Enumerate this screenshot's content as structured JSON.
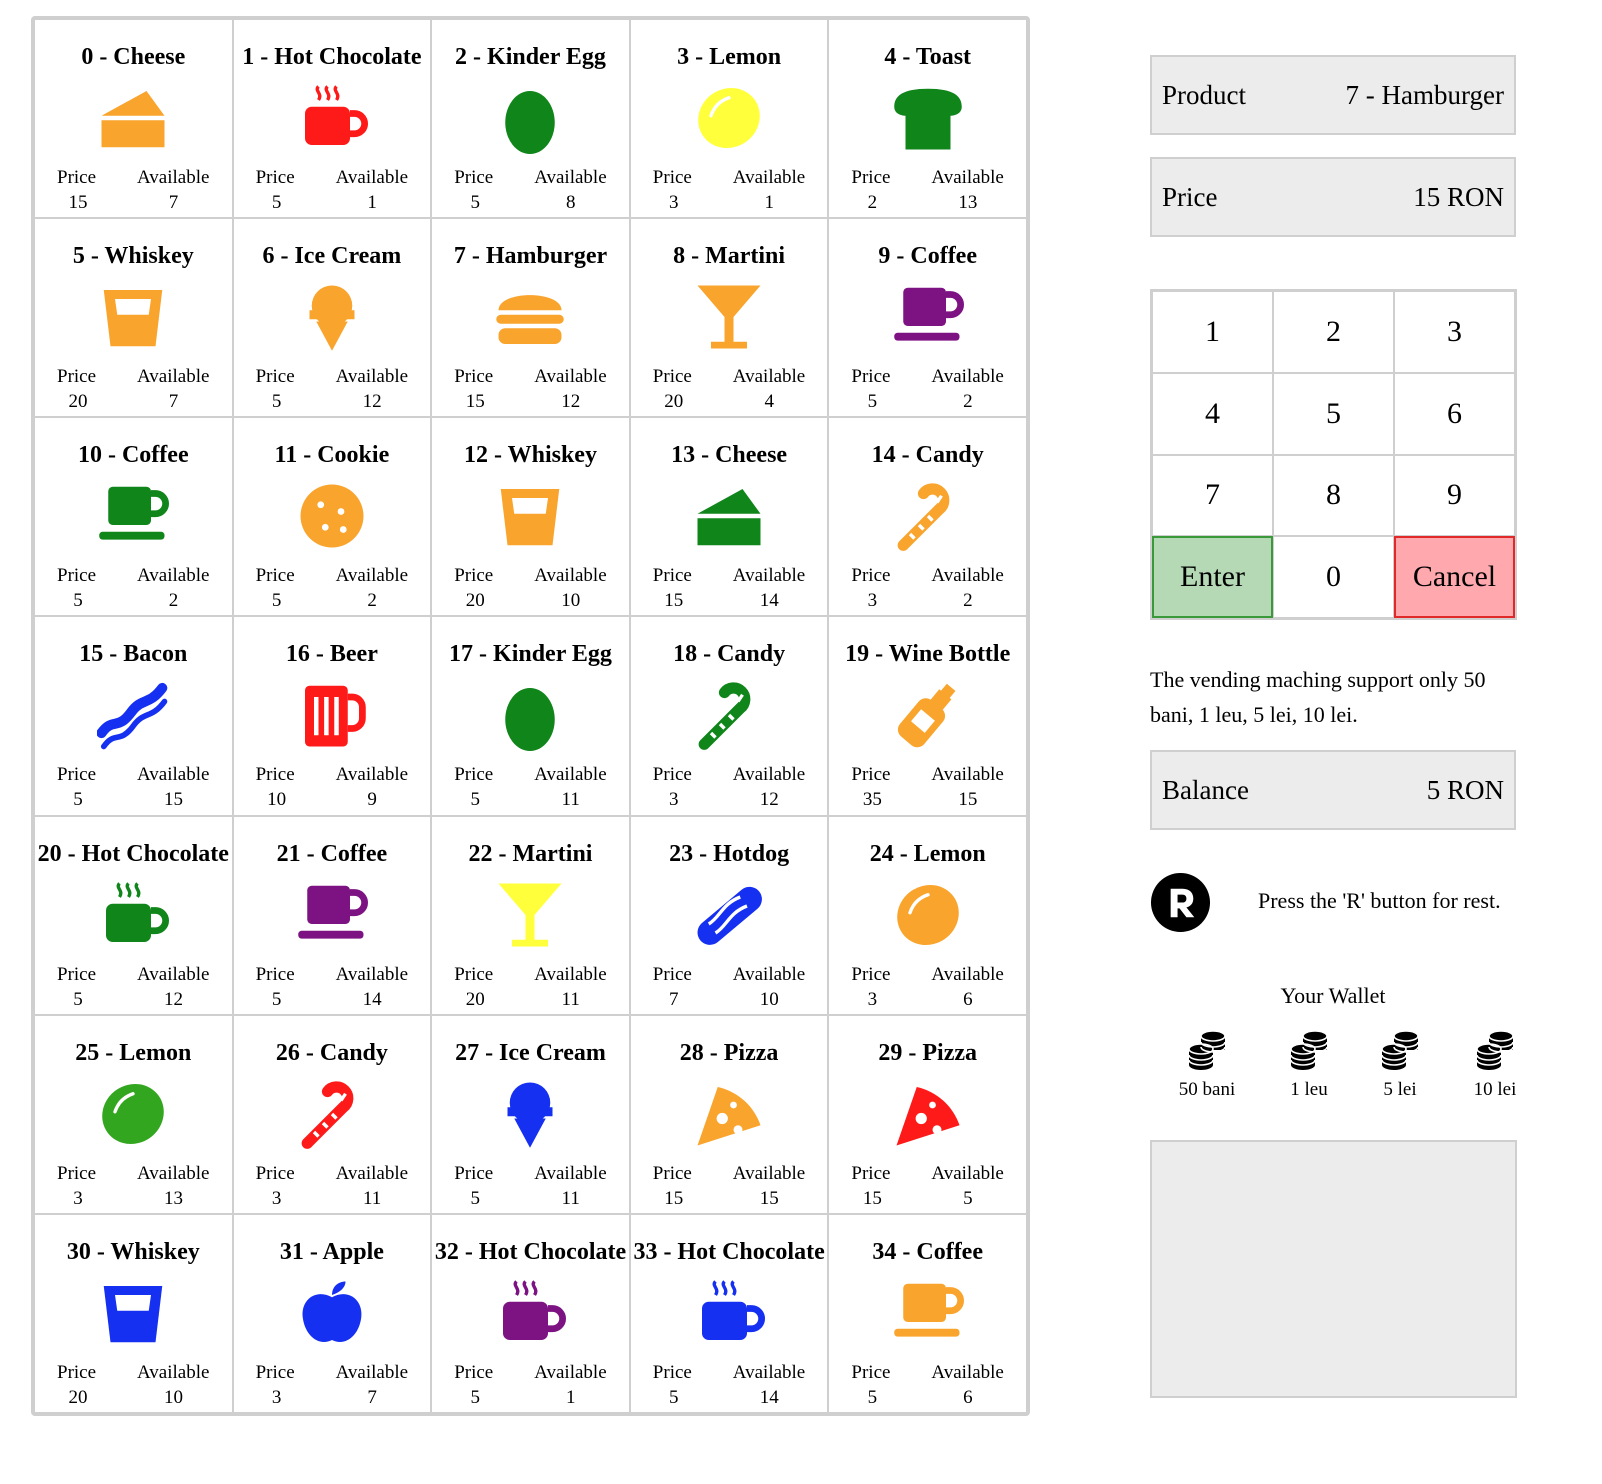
{
  "products": [
    {
      "name": "0 - Cheese",
      "icon": "cheese-icon",
      "color": "#f9a42c",
      "price": "15",
      "available": "7"
    },
    {
      "name": "1 - Hot Chocolate",
      "icon": "hot-drink-icon",
      "color": "#ff1a1a",
      "price": "5",
      "available": "1"
    },
    {
      "name": "2 - Kinder Egg",
      "icon": "egg-icon",
      "color": "#10851a",
      "price": "5",
      "available": "8"
    },
    {
      "name": "3 - Lemon",
      "icon": "lemon-icon",
      "color": "#ffff3b",
      "price": "3",
      "available": "1"
    },
    {
      "name": "4 - Toast",
      "icon": "bread-slice-icon",
      "color": "#10851a",
      "price": "2",
      "available": "13"
    },
    {
      "name": "5 - Whiskey",
      "icon": "glass-icon",
      "color": "#f9a42c",
      "price": "20",
      "available": "7"
    },
    {
      "name": "6 - Ice Cream",
      "icon": "ice-cream-icon",
      "color": "#f9a42c",
      "price": "5",
      "available": "12"
    },
    {
      "name": "7 - Hamburger",
      "icon": "hamburger-icon",
      "color": "#f9a42c",
      "price": "15",
      "available": "12"
    },
    {
      "name": "8 - Martini",
      "icon": "martini-glass-icon",
      "color": "#f9a42c",
      "price": "20",
      "available": "4"
    },
    {
      "name": "9 - Coffee",
      "icon": "coffee-cup-icon",
      "color": "#7d1383",
      "price": "5",
      "available": "2"
    },
    {
      "name": "10 - Coffee",
      "icon": "coffee-cup-icon",
      "color": "#10851a",
      "price": "5",
      "available": "2"
    },
    {
      "name": "11 - Cookie",
      "icon": "cookie-icon",
      "color": "#f9a42c",
      "price": "5",
      "available": "2"
    },
    {
      "name": "12 - Whiskey",
      "icon": "glass-icon",
      "color": "#f9a42c",
      "price": "20",
      "available": "10"
    },
    {
      "name": "13 - Cheese",
      "icon": "cheese-icon",
      "color": "#10851a",
      "price": "15",
      "available": "14"
    },
    {
      "name": "14 - Candy",
      "icon": "candy-cane-icon",
      "color": "#f9a42c",
      "price": "3",
      "available": "2"
    },
    {
      "name": "15 - Bacon",
      "icon": "bacon-icon",
      "color": "#1530f0",
      "price": "5",
      "available": "15"
    },
    {
      "name": "16 - Beer",
      "icon": "beer-mug-icon",
      "color": "#ff1a1a",
      "price": "10",
      "available": "9"
    },
    {
      "name": "17 - Kinder Egg",
      "icon": "egg-icon",
      "color": "#10851a",
      "price": "5",
      "available": "11"
    },
    {
      "name": "18 - Candy",
      "icon": "candy-cane-icon",
      "color": "#10851a",
      "price": "3",
      "available": "12"
    },
    {
      "name": "19 - Wine Bottle",
      "icon": "wine-bottle-icon",
      "color": "#f9a42c",
      "price": "35",
      "available": "15"
    },
    {
      "name": "20 - Hot Chocolate",
      "icon": "hot-drink-icon",
      "color": "#10851a",
      "price": "5",
      "available": "12"
    },
    {
      "name": "21 - Coffee",
      "icon": "coffee-cup-icon",
      "color": "#7d1383",
      "price": "5",
      "available": "14"
    },
    {
      "name": "22 - Martini",
      "icon": "martini-glass-icon",
      "color": "#ffff3b",
      "price": "20",
      "available": "11"
    },
    {
      "name": "23 - Hotdog",
      "icon": "hotdog-icon",
      "color": "#1530f0",
      "price": "7",
      "available": "10"
    },
    {
      "name": "24 - Lemon",
      "icon": "lemon-icon",
      "color": "#f9a42c",
      "price": "3",
      "available": "6"
    },
    {
      "name": "25 - Lemon",
      "icon": "lemon-icon",
      "color": "#33a61f",
      "price": "3",
      "available": "13"
    },
    {
      "name": "26 - Candy",
      "icon": "candy-cane-icon",
      "color": "#ff1a1a",
      "price": "3",
      "available": "11"
    },
    {
      "name": "27 - Ice Cream",
      "icon": "ice-cream-icon",
      "color": "#1530f0",
      "price": "5",
      "available": "11"
    },
    {
      "name": "28 - Pizza",
      "icon": "pizza-slice-icon",
      "color": "#f9a42c",
      "price": "15",
      "available": "15"
    },
    {
      "name": "29 - Pizza",
      "icon": "pizza-slice-icon",
      "color": "#ff1a1a",
      "price": "15",
      "available": "5"
    },
    {
      "name": "30 - Whiskey",
      "icon": "glass-icon",
      "color": "#1530f0",
      "price": "20",
      "available": "10"
    },
    {
      "name": "31 - Apple",
      "icon": "apple-icon",
      "color": "#1530f0",
      "price": "3",
      "available": "7"
    },
    {
      "name": "32 - Hot Chocolate",
      "icon": "hot-drink-icon",
      "color": "#7d1383",
      "price": "5",
      "available": "1"
    },
    {
      "name": "33 - Hot Chocolate",
      "icon": "hot-drink-icon",
      "color": "#1530f0",
      "price": "5",
      "available": "14"
    },
    {
      "name": "34 - Coffee",
      "icon": "coffee-cup-icon",
      "color": "#f9a42c",
      "price": "5",
      "available": "6"
    }
  ],
  "labels": {
    "price": "Price",
    "available": "Available"
  },
  "selected": {
    "product_label": "Product",
    "product_value": "7 - Hamburger",
    "price_label": "Price",
    "price_value": "15 RON"
  },
  "keypad": [
    "1",
    "2",
    "3",
    "4",
    "5",
    "6",
    "7",
    "8",
    "9",
    "Enter",
    "0",
    "Cancel"
  ],
  "notice": "The vending maching support only 50 bani, 1 leu, 5 lei, 10 lei.",
  "balance": {
    "label": "Balance",
    "value": "5 RON"
  },
  "rest": {
    "button_icon": "r-circle-icon",
    "text": "Press the 'R' button for rest."
  },
  "wallet": {
    "title": "Your Wallet",
    "coins": [
      "50 bani",
      "1 leu",
      "5 lei",
      "10 lei"
    ],
    "icon": "coins-icon"
  },
  "colors": {
    "enter_bg": "#b5d9b5",
    "cancel_bg": "#ffa9ae",
    "panel_bg": "#ececec",
    "border": "#cfcfcf"
  }
}
